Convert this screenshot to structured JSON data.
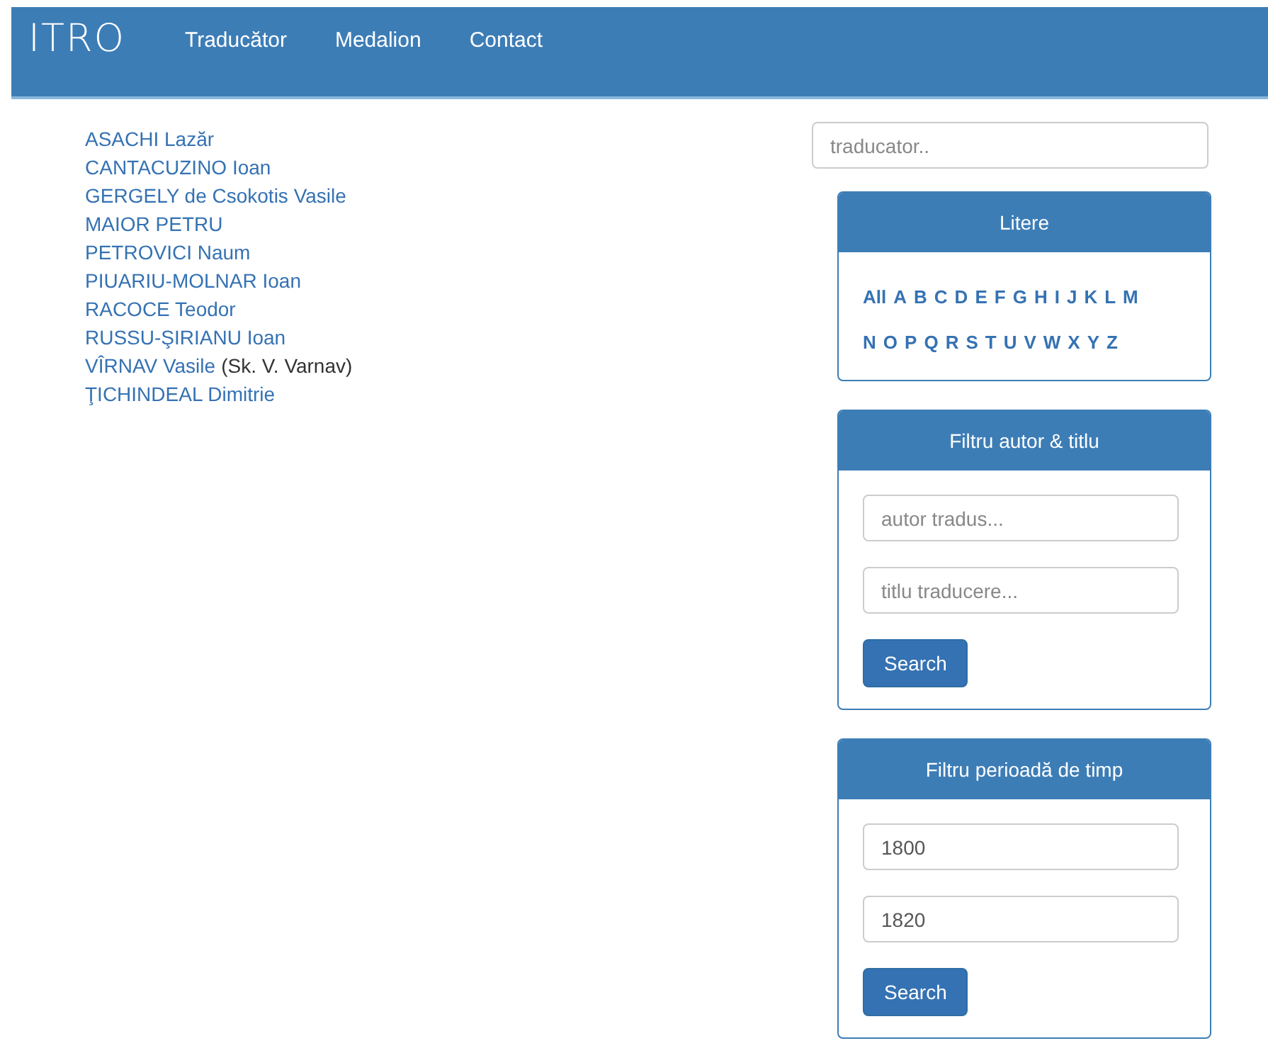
{
  "header": {
    "logo": "ITRO",
    "nav": [
      "Traducător",
      "Medalion",
      "Contact"
    ]
  },
  "translators": [
    {
      "name": "ASACHI Lazăr"
    },
    {
      "name": "CANTACUZINO Ioan"
    },
    {
      "name": "GERGELY de Csokotis Vasile"
    },
    {
      "name": "MAIOR PETRU"
    },
    {
      "name": "PETROVICI Naum"
    },
    {
      "name": "PIUARIU-MOLNAR Ioan"
    },
    {
      "name": "RACOCE Teodor"
    },
    {
      "name": "RUSSU-ŞIRIANU Ioan"
    },
    {
      "name": "VÎRNAV Vasile",
      "note": "(Sk. V. Varnav)"
    },
    {
      "name": "ŢICHINDEAL Dimitrie"
    }
  ],
  "search": {
    "placeholder": "traducator.."
  },
  "letters_panel": {
    "title": "Litere",
    "rows": [
      [
        "All",
        "A",
        "B",
        "C",
        "D",
        "E",
        "F",
        "G",
        "H",
        "I",
        "J",
        "K",
        "L",
        "M"
      ],
      [
        "N",
        "O",
        "P",
        "Q",
        "R",
        "S",
        "T",
        "U",
        "V",
        "W",
        "X",
        "Y",
        "Z"
      ]
    ]
  },
  "author_title_panel": {
    "title": "Filtru autor & titlu",
    "fields": [
      {
        "placeholder": "autor tradus..."
      },
      {
        "placeholder": "titlu traducere..."
      }
    ],
    "button": "Search"
  },
  "period_panel": {
    "title": "Filtru perioadă de timp",
    "fields": [
      {
        "value": "1800"
      },
      {
        "value": "1820"
      }
    ],
    "button": "Search"
  }
}
